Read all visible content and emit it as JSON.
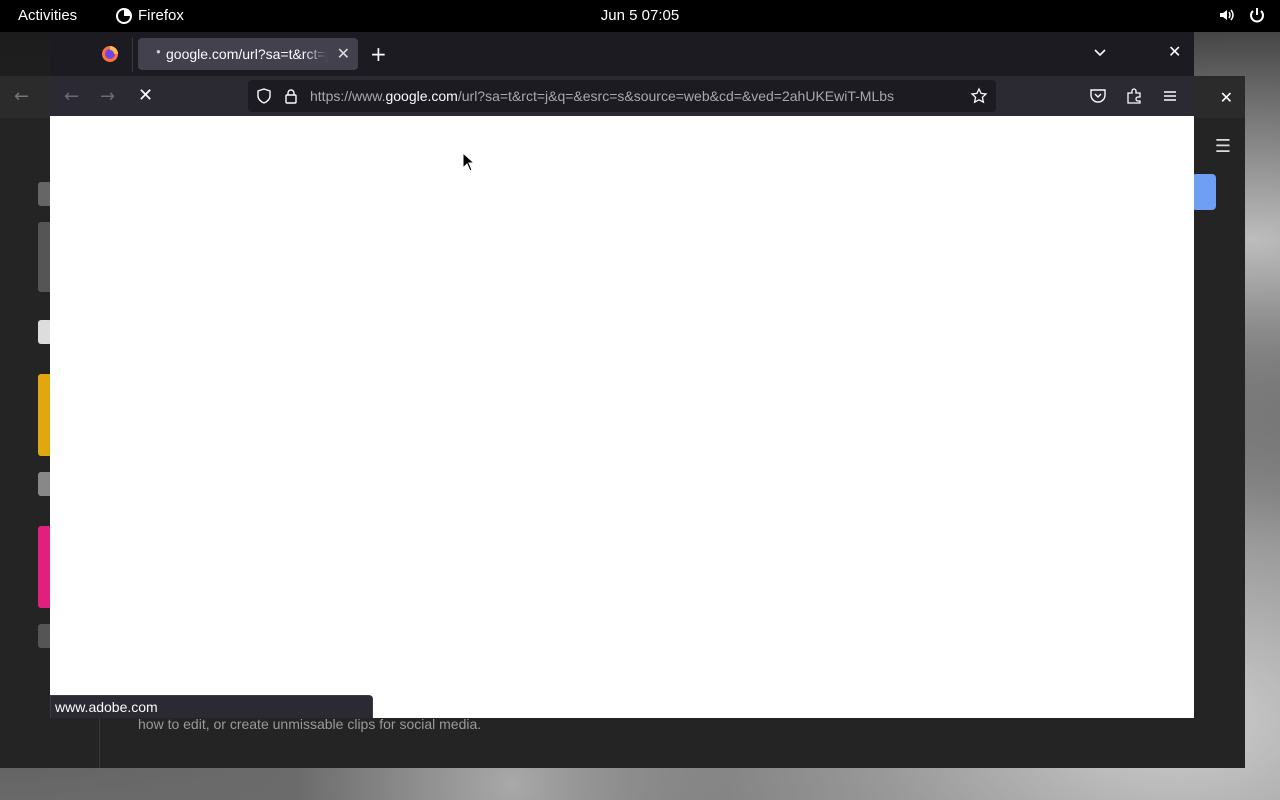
{
  "topbar": {
    "activities": "Activities",
    "app_name": "Firefox",
    "clock": "Jun 5  07:05",
    "tray_icons": [
      "volume-icon",
      "power-icon"
    ]
  },
  "background_window": {
    "snippet_text": "how to edit, or create unmissable clips for social media.",
    "accent_color": "#6f9ef5"
  },
  "firefox": {
    "tab": {
      "title": "google.com/url?sa=t&rct=j&q=&esrc=s",
      "loading": true
    },
    "urlbar": {
      "prefix": "https://www.",
      "domain": "google.com",
      "path": "/url?sa=t&rct=j&q=&esrc=s&source=web&cd=&ved=2ahUKEwiT-MLbs"
    },
    "status_text": "www.adobe.com",
    "colors": {
      "toolbar": "#2b2a33",
      "tabbar": "#1c1b22",
      "active_tab": "#42414d",
      "content": "#ffffff"
    }
  }
}
